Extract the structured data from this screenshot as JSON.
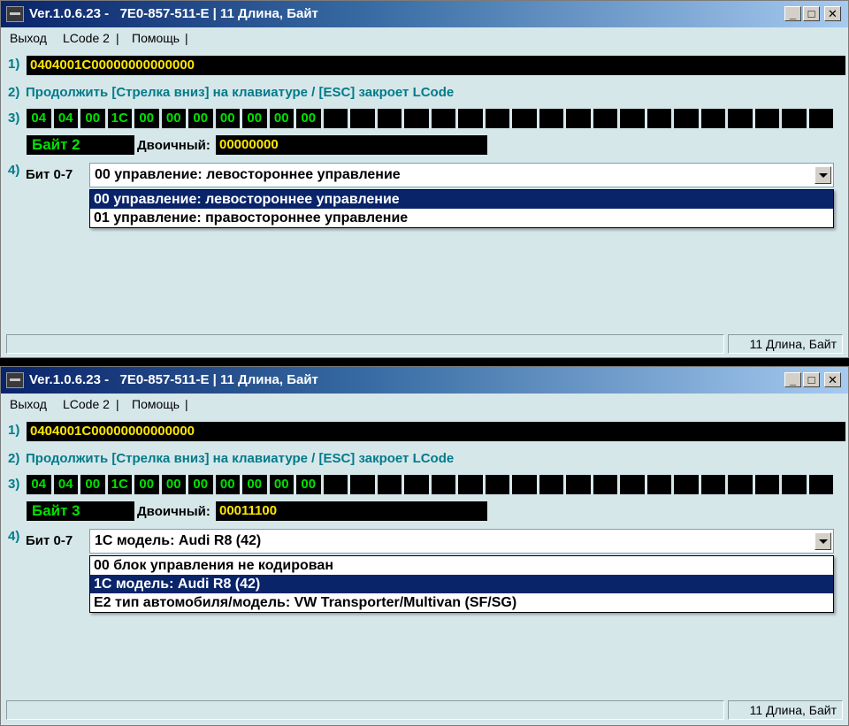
{
  "windows": [
    {
      "title": "Ver.1.0.6.23 -   7E0-857-511-E | 11 Длина, Байт",
      "menu": [
        "Выход",
        "LCode 2",
        "Помощь"
      ],
      "row_labels": [
        "1)",
        "2)",
        "3)",
        "4)"
      ],
      "coding_string": "0404001C00000000000000",
      "instruction": "Продолжить [Стрелка вниз] на клавиатуре / [ESC] закроет LCode",
      "hex_bytes": [
        "04",
        "04",
        "00",
        "1C",
        "00",
        "00",
        "00",
        "00",
        "00",
        "00",
        "00",
        "",
        "",
        "",
        "",
        "",
        "",
        "",
        "",
        "",
        "",
        "",
        "",
        "",
        "",
        "",
        "",
        "",
        "",
        ""
      ],
      "byte_label": "Байт 2",
      "binary_label": "Двоичный:",
      "binary_value": "00000000",
      "bit_label": "Бит 0-7",
      "combo_value": "00 управление: левостороннее управление",
      "dropdown_options": [
        {
          "label": "00 управление: левостороннее управление",
          "selected": true
        },
        {
          "label": "01 управление: правостороннее управление",
          "selected": false
        }
      ],
      "status_right": "11 Длина, Байт"
    },
    {
      "title": "Ver.1.0.6.23 -   7E0-857-511-E | 11 Длина, Байт",
      "menu": [
        "Выход",
        "LCode 2",
        "Помощь"
      ],
      "row_labels": [
        "1)",
        "2)",
        "3)",
        "4)"
      ],
      "coding_string": "0404001C00000000000000",
      "instruction": "Продолжить [Стрелка вниз] на клавиатуре / [ESC] закроет LCode",
      "hex_bytes": [
        "04",
        "04",
        "00",
        "1C",
        "00",
        "00",
        "00",
        "00",
        "00",
        "00",
        "00",
        "",
        "",
        "",
        "",
        "",
        "",
        "",
        "",
        "",
        "",
        "",
        "",
        "",
        "",
        "",
        "",
        "",
        "",
        ""
      ],
      "byte_label": "Байт 3",
      "binary_label": "Двоичный:",
      "binary_value": "00011100",
      "bit_label": "Бит 0-7",
      "combo_value": "1C модель: Audi R8 (42)",
      "dropdown_options": [
        {
          "label": "00 блок управления не кодирован",
          "selected": false
        },
        {
          "label": "1C модель: Audi R8 (42)",
          "selected": true
        },
        {
          "label": "E2 тип автомобиля/модель: VW Transporter/Multivan (SF/SG)",
          "selected": false
        }
      ],
      "status_right": "11 Длина, Байт"
    }
  ],
  "colors": {
    "window_bg": "#d6e7ea",
    "title_gradient_start": "#0a246a",
    "accent_teal": "#007b8a",
    "coding_text": "#ffe600",
    "hex_text": "#00e000",
    "selection_bg": "#0a246a"
  }
}
